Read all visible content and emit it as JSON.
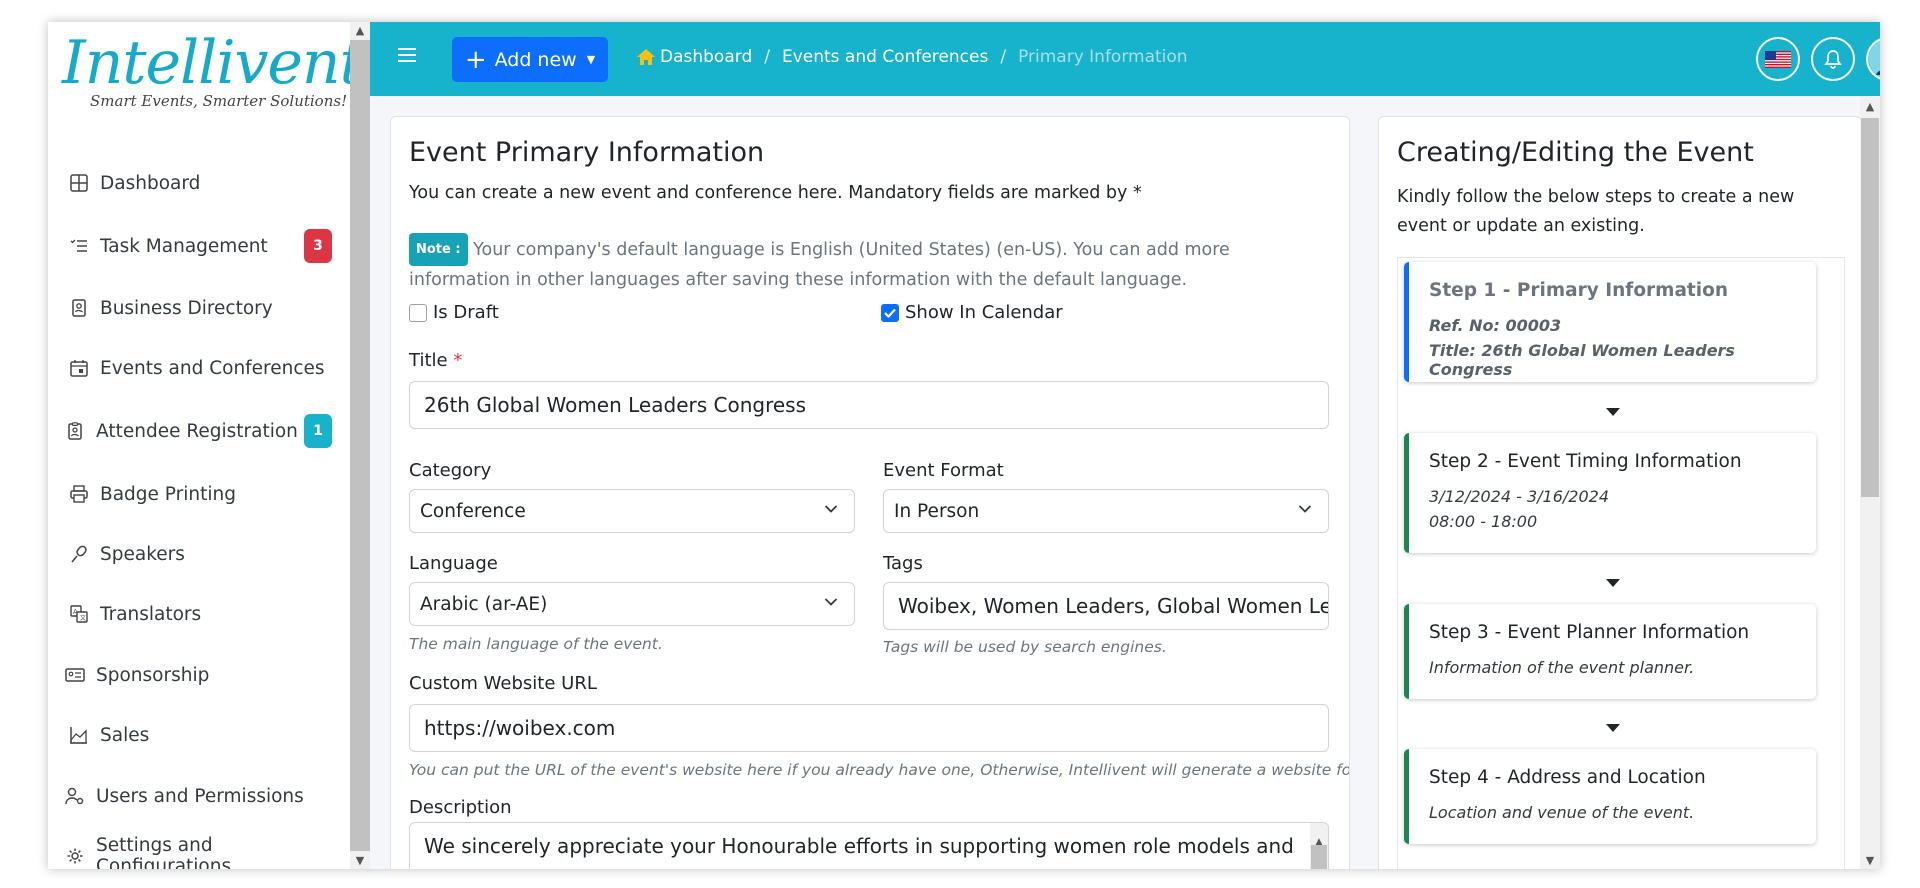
{
  "brand": {
    "name": "Intellivent",
    "tagline": "Smart Events, Smarter Solutions!"
  },
  "sidebar": {
    "items": [
      {
        "label": "Dashboard",
        "icon": "dashboard-icon"
      },
      {
        "label": "Task Management",
        "icon": "task-list-icon",
        "badge": "3",
        "badge_color": "#dc3545"
      },
      {
        "label": "Business Directory",
        "icon": "contact-book-icon"
      },
      {
        "label": "Events and Conferences",
        "icon": "calendar-icon"
      },
      {
        "label": "Attendee Registration",
        "icon": "clipboard-user-icon",
        "badge": "1",
        "badge_color": "#17b2cc"
      },
      {
        "label": "Badge Printing",
        "icon": "printer-icon"
      },
      {
        "label": "Speakers",
        "icon": "microphone-icon"
      },
      {
        "label": "Translators",
        "icon": "translate-icon"
      },
      {
        "label": "Sponsorship",
        "icon": "id-card-icon"
      },
      {
        "label": "Sales",
        "icon": "chart-icon"
      },
      {
        "label": "Users and Permissions",
        "icon": "user-gear-icon"
      },
      {
        "label": "Settings and Configurations",
        "icon": "gear-icon"
      }
    ]
  },
  "topbar": {
    "add_new_label": "Add new",
    "breadcrumb": [
      "Dashboard",
      "Events and Conferences",
      "Primary Information"
    ],
    "accent": "#17b2cc",
    "primary": "#0d6efd"
  },
  "main": {
    "title": "Event Primary Information",
    "subtitle": "You can create a new event and conference here. Mandatory fields are marked by *",
    "note_badge": "Note :",
    "note_text": " Your company's default language is English (United States) (en-US). You can add more information in other languages after saving these information with the default language.",
    "is_draft_label": "Is Draft",
    "is_draft_checked": false,
    "show_in_calendar_label": "Show In Calendar",
    "show_in_calendar_checked": true,
    "title_label": "Title",
    "title_value": "26th Global Women Leaders Congress",
    "category_label": "Category",
    "category_value": "Conference",
    "event_format_label": "Event Format",
    "event_format_value": "In Person",
    "language_label": "Language",
    "language_value": "Arabic (ar-AE)",
    "language_help": "The main language of the event.",
    "tags_label": "Tags",
    "tags_value": "Woibex, Women Leaders, Global Women Lea",
    "tags_help": "Tags will be used by search engines.",
    "url_label": "Custom Website URL",
    "url_value": "https://woibex.com",
    "url_help": "You can put the URL of the event's website here if you already have one, Otherwise, Intellivent will generate a website for this ...",
    "description_label": "Description",
    "description_value": "We sincerely appreciate your Honourable efforts in supporting women role models and"
  },
  "side": {
    "title": "Creating/Editing the Event",
    "subtitle": "Kindly follow the below steps to create a new event or update an existing.",
    "steps": [
      {
        "title": "Step 1 - Primary Information",
        "line1": "Ref. No: 00003",
        "line2": "Title: 26th Global Women Leaders Congress"
      },
      {
        "title": "Step 2 - Event Timing Information",
        "line1": "3/12/2024 - 3/16/2024",
        "line2": "08:00 - 18:00"
      },
      {
        "title": "Step 3 - Event Planner Information",
        "line1": "Information of the event planner."
      },
      {
        "title": "Step 4 - Address and Location",
        "line1": "Location and venue of the event."
      }
    ]
  }
}
